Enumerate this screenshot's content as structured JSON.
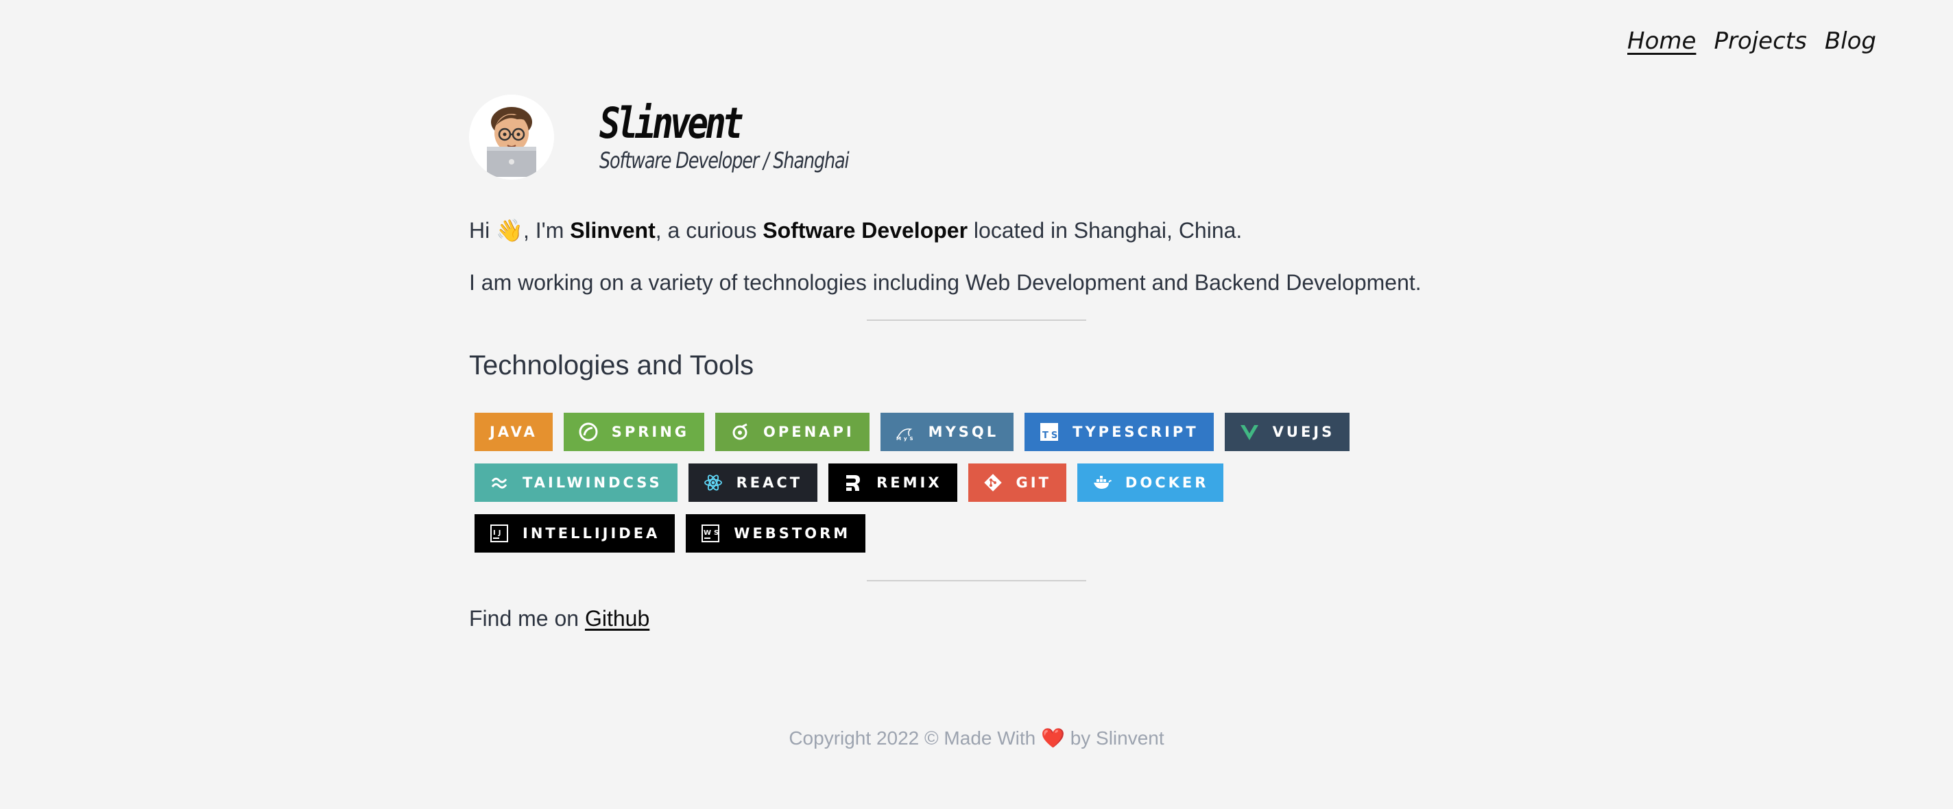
{
  "nav": {
    "items": [
      "Home",
      "Projects",
      "Blog"
    ]
  },
  "profile": {
    "name": "Slinvent",
    "subtitle": "Software Developer / Shanghai"
  },
  "intro": {
    "hi": "Hi",
    "wave": "👋",
    "im": ", I'm",
    "name": "Slinvent",
    "a_curious": ", a curious",
    "role": "Software Developer",
    "location": "located in Shanghai, China."
  },
  "work_text": "I am working on a variety of technologies including Web Development and Backend Development.",
  "tech": {
    "heading": "Technologies and Tools",
    "badges": [
      {
        "label": "JAVA",
        "color": "#e5912f",
        "icon": ""
      },
      {
        "label": "SPRING",
        "color": "#6cad46",
        "icon": "spring-icon"
      },
      {
        "label": "OPENAPI",
        "color": "#6ba543",
        "icon": "openapi-icon"
      },
      {
        "label": "MYSQL",
        "color": "#4a7ba0",
        "icon": "mysql-icon"
      },
      {
        "label": "TYPESCRIPT",
        "color": "#3178c6",
        "icon": "typescript-icon"
      },
      {
        "label": "VUEJS",
        "color": "#35495e",
        "icon": "vue-icon"
      },
      {
        "label": "TAILWINDCSS",
        "color": "#4fb0a6",
        "icon": "tailwind-icon"
      },
      {
        "label": "REACT",
        "color": "#20232a",
        "icon": "react-icon"
      },
      {
        "label": "REMIX",
        "color": "#000000",
        "icon": "remix-icon"
      },
      {
        "label": "GIT",
        "color": "#e05a45",
        "icon": "git-icon"
      },
      {
        "label": "DOCKER",
        "color": "#3aa7e6",
        "icon": "docker-icon"
      },
      {
        "label": "INTELLIJIDEA",
        "color": "#000000",
        "icon": "intellij-icon"
      },
      {
        "label": "WEBSTORM",
        "color": "#000000",
        "icon": "webstorm-icon"
      }
    ]
  },
  "find": {
    "prefix": "Find me on",
    "link": "Github"
  },
  "footer": {
    "left": "Copyright 2022 © Made With",
    "heart": "❤️",
    "right": "by Slinvent"
  }
}
